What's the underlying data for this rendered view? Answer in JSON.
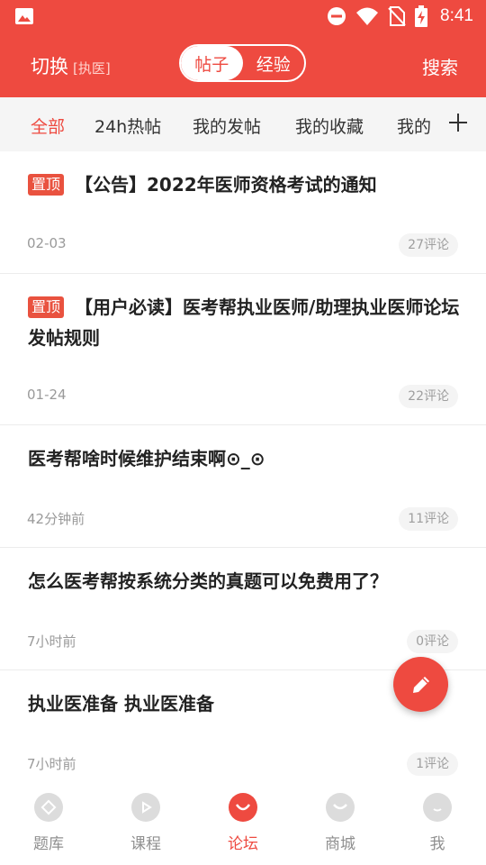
{
  "status_bar": {
    "time": "8:41",
    "icons": [
      "image-icon",
      "dnd-icon",
      "wifi-icon",
      "no-sim-icon",
      "battery-charging-icon"
    ]
  },
  "header": {
    "switch_label": "切换",
    "switch_sub": "[执医]",
    "segments": [
      {
        "label": "帖子",
        "active": true
      },
      {
        "label": "经验",
        "active": false
      }
    ],
    "search_label": "搜索",
    "accent_color": "#ee4a40"
  },
  "tabs": {
    "items": [
      "全部",
      "24h热帖",
      "我的发帖",
      "我的收藏",
      "我的"
    ],
    "active_index": 0
  },
  "posts": [
    {
      "pinned": true,
      "pin_label": "置顶",
      "title": "【公告】2022年医师资格考试的通知",
      "date": "02-03",
      "comments": "27评论"
    },
    {
      "pinned": true,
      "pin_label": "置顶",
      "title": "【用户必读】医考帮执业医师/助理执业医师论坛发帖规则",
      "date": "01-24",
      "comments": "22评论"
    },
    {
      "pinned": false,
      "title": "医考帮啥时候维护结束啊⊙_⊙",
      "date": "42分钟前",
      "comments": "11评论"
    },
    {
      "pinned": false,
      "title": "怎么医考帮按系统分类的真题可以免费用了？",
      "date": "7小时前",
      "comments": "0评论"
    },
    {
      "pinned": false,
      "title": "执业医准备 执业医准备",
      "date": "7小时前",
      "comments": "1评论"
    }
  ],
  "fab": {
    "icon": "pencil-icon"
  },
  "bottom_nav": {
    "items": [
      {
        "label": "题库",
        "icon": "question-bank-icon"
      },
      {
        "label": "课程",
        "icon": "play-icon"
      },
      {
        "label": "论坛",
        "icon": "forum-smile-icon"
      },
      {
        "label": "商城",
        "icon": "shop-icon"
      },
      {
        "label": "我",
        "icon": "profile-icon"
      }
    ],
    "active_index": 2
  }
}
